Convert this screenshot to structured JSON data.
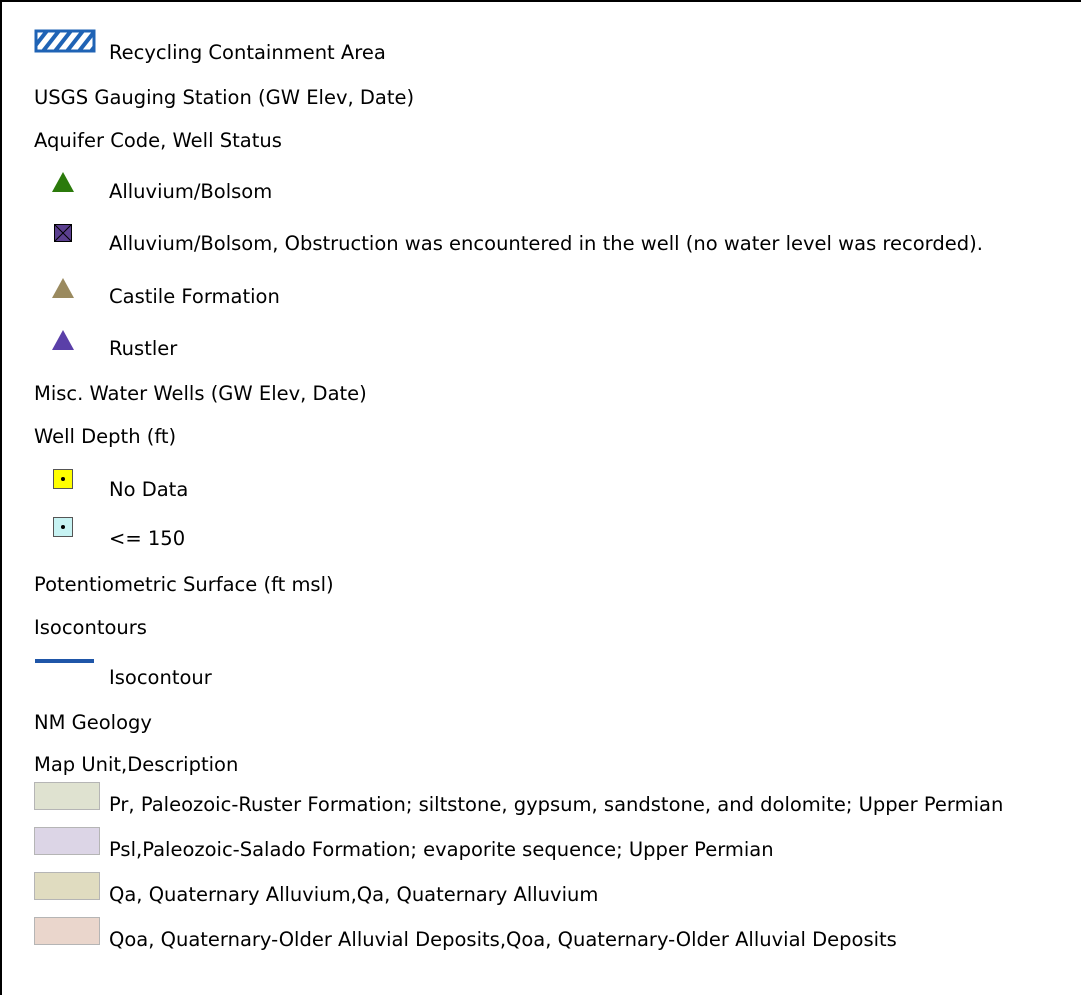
{
  "legend": {
    "recycling": {
      "label": "Recycling Containment Area",
      "color": "#1f63b5"
    },
    "usgs_header": "USGS Gauging Station (GW Elev, Date)",
    "aquifer_header": "Aquifer Code, Well Status",
    "aquifer_items": [
      {
        "label": "Alluvium/Bolsom",
        "color": "#2b7a0b",
        "icon": "triangle-icon"
      },
      {
        "label": "Alluvium/Bolsom, Obstruction was encountered in the well (no water level was recorded).",
        "color": "#5b3f8f",
        "icon": "crossed-square-icon"
      },
      {
        "label": "Castile Formation",
        "color": "#9a8a5f",
        "icon": "triangle-icon"
      },
      {
        "label": "Rustler",
        "color": "#5a3fa8",
        "icon": "triangle-icon"
      }
    ],
    "misc_header": "Misc. Water Wells (GW Elev, Date)",
    "depth_header": "Well Depth (ft)",
    "depth_items": [
      {
        "label": "No Data",
        "color": "#ffff00",
        "icon": "dotted-square-icon"
      },
      {
        "label": "<= 150",
        "color": "#c7f3f3",
        "icon": "dotted-square-icon"
      }
    ],
    "pot_header": "Potentiometric Surface (ft msl)",
    "iso_header": "Isocontours",
    "iso_item": {
      "label": "Isocontour",
      "color": "#1f56a8",
      "icon": "line-icon"
    },
    "geology_header": "NM Geology",
    "mapunit_header": "Map Unit,Description",
    "geology_items": [
      {
        "label": "Pr, Paleozoic-Ruster Formation; siltstone, gypsum, sandstone, and dolomite; Upper Permian",
        "color": "#dfe2d0"
      },
      {
        "label": "Psl,Paleozoic-Salado Formation; evaporite sequence; Upper Permian",
        "color": "#dcd5e6"
      },
      {
        "label": "Qa, Quaternary Alluvium,Qa, Quaternary Alluvium",
        "color": "#e0dcc0"
      },
      {
        "label": "Qoa, Quaternary-Older Alluvial Deposits,Qoa, Quaternary-Older Alluvial Deposits",
        "color": "#ead6cc"
      }
    ]
  }
}
